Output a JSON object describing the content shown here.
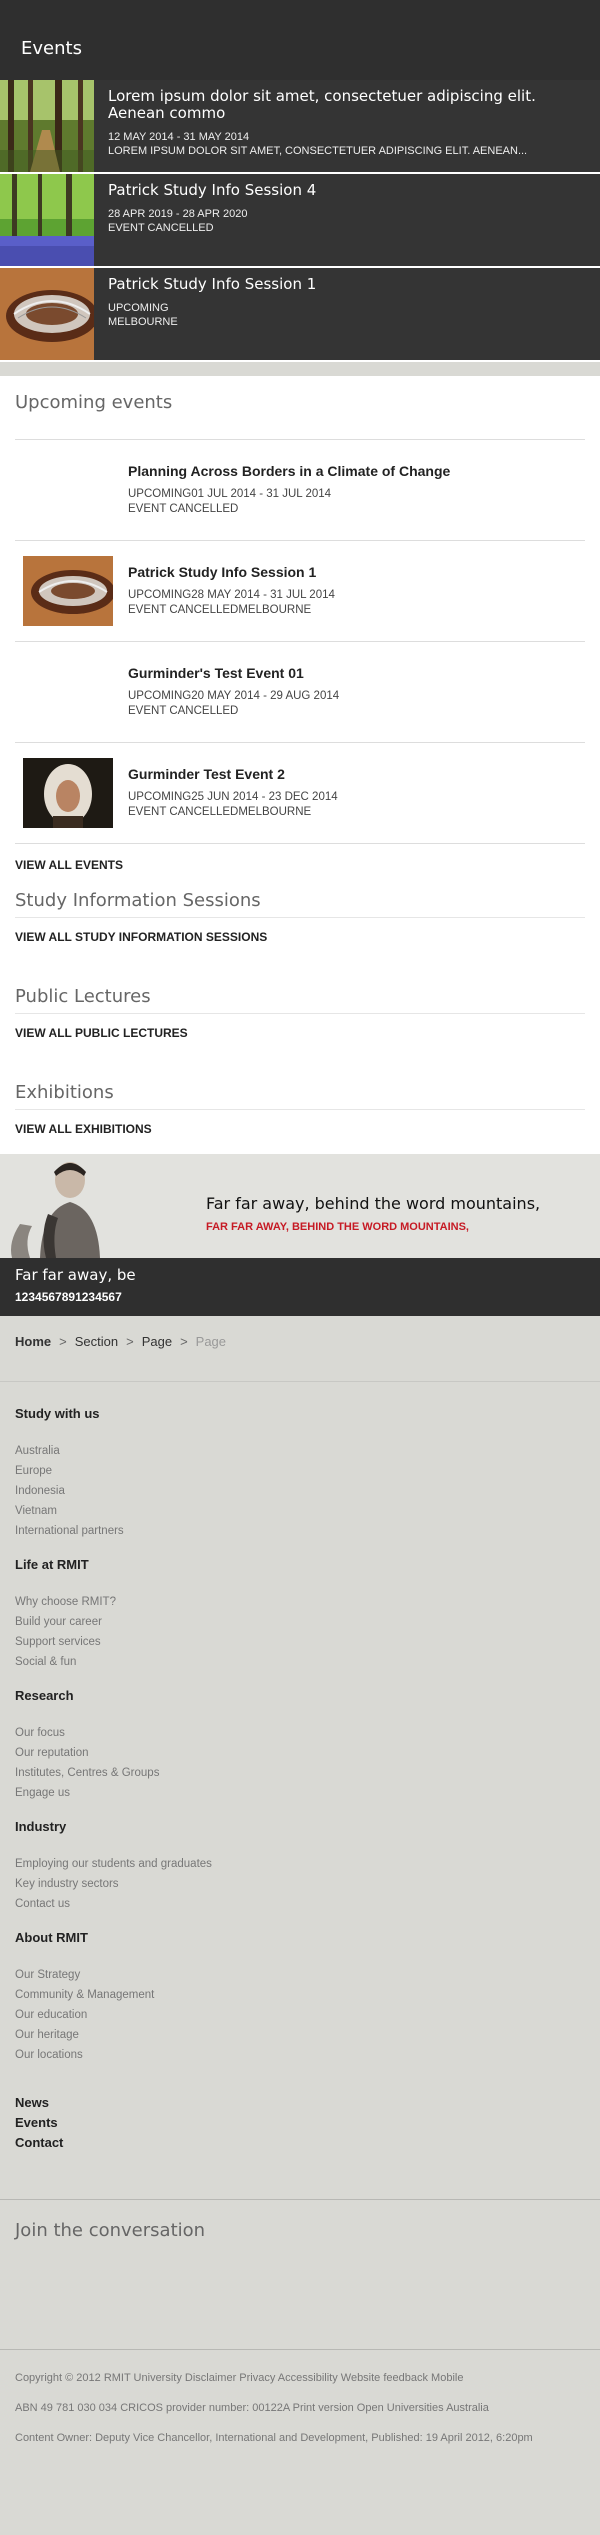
{
  "header": {
    "title": "Events"
  },
  "featured": [
    {
      "title": "Lorem ipsum dolor sit amet, consectetuer adipiscing elit. Aenean commo",
      "line1": "12 MAY 2014 - 31 MAY 2014",
      "line2": "LOREM IPSUM DOLOR SIT AMET, CONSECTETUER ADIPISCING ELIT. AENEAN...",
      "image": "forest-path-photo"
    },
    {
      "title": "Patrick Study Info Session 4",
      "line1": "28 APR 2019 - 28 APR 2020",
      "line2": "EVENT CANCELLED",
      "image": "bluebell-woods-photo"
    },
    {
      "title": "Patrick Study Info Session 1",
      "line1": "UPCOMING",
      "line2": "MELBOURNE",
      "image": "piano-mechanism-photo"
    }
  ],
  "upcoming": {
    "title": "Upcoming events",
    "events": [
      {
        "title": "Planning Across Borders in a Climate of Change",
        "line1": "UPCOMING01 JUL 2014 - 31 JUL 2014",
        "line2": "EVENT CANCELLED",
        "image": ""
      },
      {
        "title": "Patrick Study Info Session 1",
        "line1": "UPCOMING28 MAY 2014 - 31 JUL 2014",
        "line2": "EVENT CANCELLEDMELBOURNE",
        "image": "piano-mechanism-photo"
      },
      {
        "title": "Gurminder's Test Event 01",
        "line1": "UPCOMING20 MAY 2014 - 29 AUG 2014",
        "line2": "EVENT CANCELLED",
        "image": ""
      },
      {
        "title": "Gurminder Test Event 2",
        "line1": "UPCOMING25 JUN 2014 - 23 DEC 2014",
        "line2": "EVENT CANCELLEDMELBOURNE",
        "image": "portrait-painting"
      }
    ],
    "view_all": "VIEW ALL EVENTS"
  },
  "study_sessions": {
    "title": "Study Information Sessions",
    "link": "VIEW ALL STUDY INFORMATION SESSIONS"
  },
  "public_lectures": {
    "title": "Public Lectures",
    "link": "VIEW ALL PUBLIC LECTURES"
  },
  "exhibitions": {
    "title": "Exhibitions",
    "link": "VIEW ALL EXHIBITIONS"
  },
  "promo": {
    "headline": "Far far away, behind the word mountains,",
    "subhead": "FAR FAR AWAY, BEHIND THE WORD MOUNTAINS,",
    "bar_heading": "Far far away, be",
    "bar_number": "1234567891234567"
  },
  "breadcrumb": {
    "home": "Home",
    "section": "Section",
    "page": "Page",
    "current": "Page"
  },
  "footer_nav": [
    {
      "heading": "Study with us",
      "links": [
        "Australia",
        "Europe",
        "Indonesia",
        "Vietnam",
        "International partners"
      ]
    },
    {
      "heading": "Life at RMIT",
      "links": [
        "Why choose RMIT?",
        "Build your career",
        "Support services",
        "Social & fun"
      ]
    },
    {
      "heading": "Research",
      "links": [
        "Our focus",
        "Our reputation",
        "Institutes, Centres & Groups",
        "Engage us"
      ]
    },
    {
      "heading": "Industry",
      "links": [
        "Employing our students and graduates",
        "Key industry sectors",
        "Contact us"
      ]
    },
    {
      "heading": "About RMIT",
      "links": [
        "Our Strategy",
        "Community & Management",
        "Our education",
        "Our heritage",
        "Our locations"
      ]
    }
  ],
  "footer_extra": [
    "News",
    "Events",
    "Contact"
  ],
  "join": {
    "title": "Join the conversation"
  },
  "legal": {
    "line1": "Copyright © 2012 RMIT University Disclaimer Privacy Accessibility Website feedback Mobile",
    "line2": "ABN 49 781 030 034 CRICOS provider number: 00122A Print version Open Universities Australia",
    "line3": "Content Owner: Deputy Vice Chancellor, International and Development, Published: 19 April 2012, 6:20pm"
  }
}
